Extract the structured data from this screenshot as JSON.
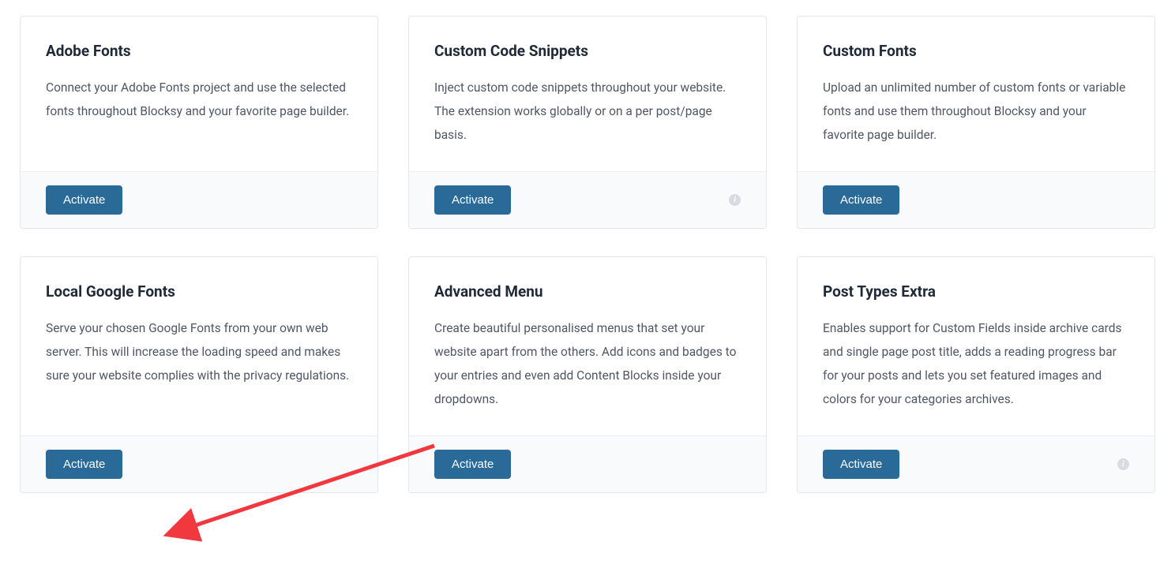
{
  "cards": [
    {
      "title": "Adobe Fonts",
      "description": "Connect your Adobe Fonts project and use the selected fonts throughout Blocksy and your favorite page builder.",
      "action_label": "Activate",
      "has_info": false
    },
    {
      "title": "Custom Code Snippets",
      "description": "Inject custom code snippets throughout your website. The extension works globally or on a per post/page basis.",
      "action_label": "Activate",
      "has_info": true
    },
    {
      "title": "Custom Fonts",
      "description": "Upload an unlimited number of custom fonts or variable fonts and use them throughout Blocksy and your favorite page builder.",
      "action_label": "Activate",
      "has_info": false
    },
    {
      "title": "Local Google Fonts",
      "description": "Serve your chosen Google Fonts from your own web server. This will increase the loading speed and makes sure your website complies with the privacy regulations.",
      "action_label": "Activate",
      "has_info": false
    },
    {
      "title": "Advanced Menu",
      "description": "Create beautiful personalised menus that set your website apart from the others. Add icons and badges to your entries and even add Content Blocks inside your dropdowns.",
      "action_label": "Activate",
      "has_info": false
    },
    {
      "title": "Post Types Extra",
      "description": "Enables support for Custom Fields inside archive cards and single page post title, adds a reading progress bar for your posts and lets you set featured images and colors for your categories archives.",
      "action_label": "Activate",
      "has_info": true
    }
  ],
  "info_char": "i"
}
